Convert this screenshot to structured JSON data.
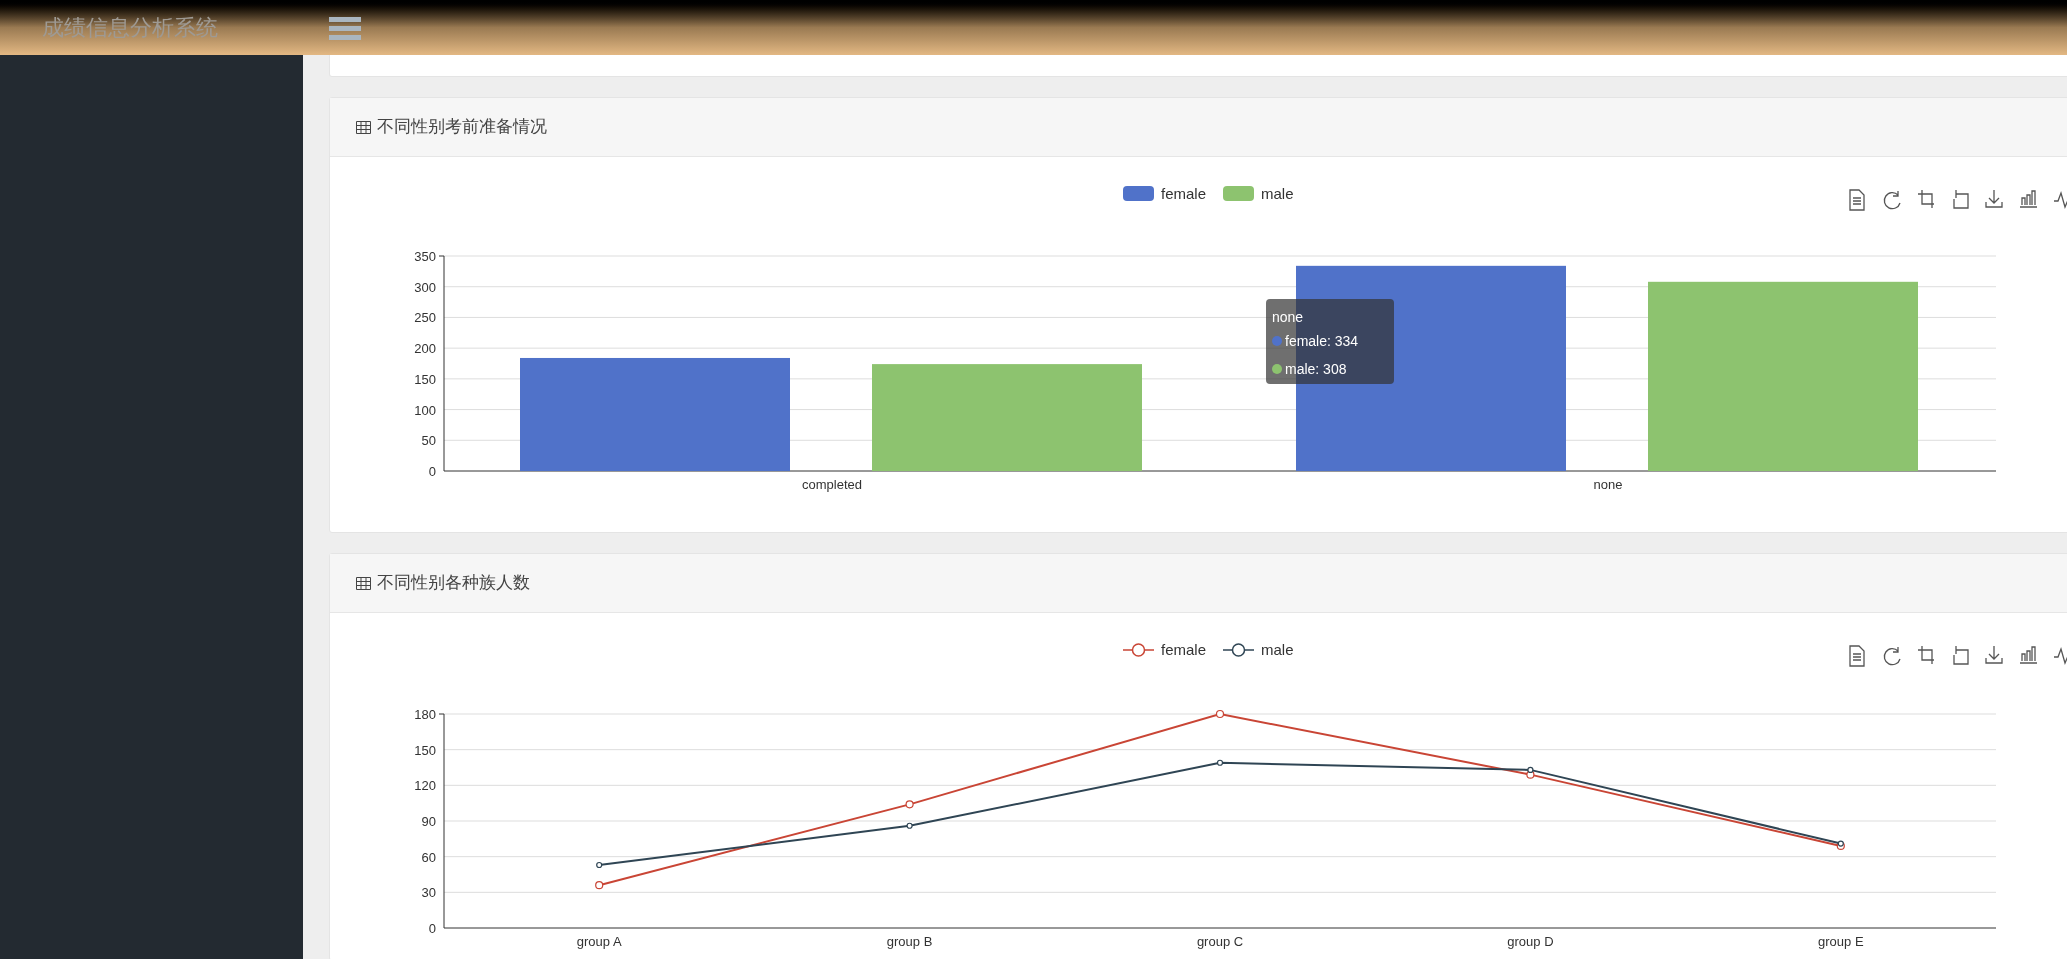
{
  "header": {
    "title": "成绩信息分析系统"
  },
  "panels": [
    {
      "title": "不同性别考前准备情况",
      "chart_data": {
        "type": "bar",
        "categories": [
          "completed",
          "none"
        ],
        "series": [
          {
            "name": "female",
            "color": "#5072c9",
            "values": [
              184,
              334
            ]
          },
          {
            "name": "male",
            "color": "#8dc36f",
            "values": [
              174,
              308
            ]
          }
        ],
        "ylim": [
          0,
          350
        ],
        "yticks": [
          0,
          50,
          100,
          150,
          200,
          250,
          300,
          350
        ],
        "grid": true,
        "legend": "top"
      },
      "tooltip": {
        "title": "none",
        "lines": [
          "female: 334",
          "male: 308"
        ]
      }
    },
    {
      "title": "不同性别各种族人数",
      "chart_data": {
        "type": "line",
        "categories": [
          "group A",
          "group B",
          "group C",
          "group D",
          "group E"
        ],
        "series": [
          {
            "name": "female",
            "color": "#c94535",
            "values": [
              36,
              104,
              180,
              129,
              69
            ],
            "marker": "circle"
          },
          {
            "name": "male",
            "color": "#2f4554",
            "values": [
              53,
              86,
              139,
              133,
              71
            ],
            "marker": "circle"
          }
        ],
        "ylim": [
          0,
          180
        ],
        "yticks": [
          0,
          30,
          60,
          90,
          120,
          150,
          180
        ],
        "grid": true,
        "legend": "top"
      }
    }
  ]
}
